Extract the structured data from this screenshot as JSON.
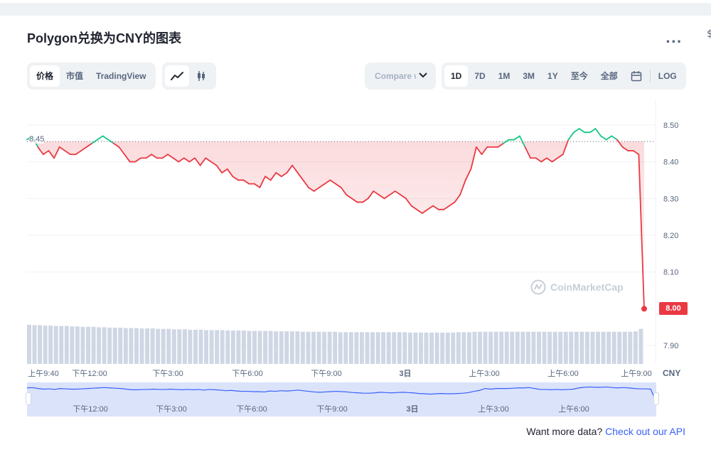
{
  "title": "Polygon兑换为CNY的图表",
  "more_label": "...",
  "edge_mark": "$",
  "view_tabs": [
    {
      "label": "价格",
      "active": true
    },
    {
      "label": "市值",
      "active": false
    },
    {
      "label": "TradingView",
      "active": false
    }
  ],
  "chart_type_icons": [
    {
      "name": "line-chart-icon",
      "active": true
    },
    {
      "name": "candlestick-icon",
      "active": false
    }
  ],
  "compare": {
    "label": "Compare with"
  },
  "ranges": [
    {
      "label": "1D",
      "active": true
    },
    {
      "label": "7D",
      "active": false
    },
    {
      "label": "1M",
      "active": false
    },
    {
      "label": "3M",
      "active": false
    },
    {
      "label": "1Y",
      "active": false
    },
    {
      "label": "至今",
      "active": false
    },
    {
      "label": "全部",
      "active": false
    }
  ],
  "calendar_icon": "calendar-icon",
  "log_label": "LOG",
  "colors": {
    "up": "#16c784",
    "down": "#ea3943",
    "grid": "#eff2f5",
    "volume": "#cfd6e4",
    "nav_fill": "#dbe3fb",
    "nav_line": "#3861fb"
  },
  "watermark": "CoinMarketCap",
  "footer": {
    "text": "Want more data?",
    "link": "Check out our API"
  },
  "chart_data": {
    "type": "line",
    "currency": "CNY",
    "ylim": [
      7.85,
      8.55
    ],
    "y_ticks": [
      "8.50",
      "8.40",
      "8.30",
      "8.20",
      "8.10",
      "7.90"
    ],
    "reference": {
      "label": "8.45",
      "value": 8.455
    },
    "last_price": {
      "label": "8.00",
      "value": 8.0
    },
    "x_tick_labels": [
      "上午9:40",
      "下午12:00",
      "下午3:00",
      "下午6:00",
      "下午9:00",
      "3日",
      "上午3:00",
      "上午6:00",
      "上午9:00"
    ],
    "nav_tick_labels": [
      "下午12:00",
      "下午3:00",
      "下午6:00",
      "下午9:00",
      "3日",
      "上午3:00",
      "上午6:00"
    ],
    "grid": true,
    "series": [
      {
        "values": [
          8.46,
          8.47,
          8.44,
          8.42,
          8.43,
          8.41,
          8.44,
          8.43,
          8.42,
          8.42,
          8.43,
          8.44,
          8.45,
          8.46,
          8.47,
          8.46,
          8.45,
          8.44,
          8.42,
          8.4,
          8.4,
          8.41,
          8.41,
          8.42,
          8.41,
          8.41,
          8.42,
          8.41,
          8.4,
          8.41,
          8.4,
          8.41,
          8.39,
          8.41,
          8.4,
          8.39,
          8.37,
          8.38,
          8.36,
          8.35,
          8.35,
          8.34,
          8.34,
          8.33,
          8.36,
          8.35,
          8.37,
          8.36,
          8.37,
          8.39,
          8.37,
          8.35,
          8.33,
          8.32,
          8.33,
          8.34,
          8.35,
          8.34,
          8.33,
          8.31,
          8.3,
          8.29,
          8.29,
          8.3,
          8.32,
          8.31,
          8.3,
          8.31,
          8.32,
          8.31,
          8.3,
          8.28,
          8.27,
          8.26,
          8.27,
          8.28,
          8.27,
          8.27,
          8.28,
          8.29,
          8.31,
          8.35,
          8.38,
          8.44,
          8.42,
          8.44,
          8.44,
          8.44,
          8.45,
          8.46,
          8.46,
          8.47,
          8.44,
          8.41,
          8.41,
          8.4,
          8.41,
          8.4,
          8.41,
          8.42,
          8.46,
          8.48,
          8.49,
          8.48,
          8.48,
          8.49,
          8.47,
          8.46,
          8.47,
          8.46,
          8.44,
          8.43,
          8.43,
          8.42,
          8.0
        ],
        "volume": [
          0.95,
          0.94,
          0.94,
          0.93,
          0.93,
          0.92,
          0.92,
          0.92,
          0.91,
          0.91,
          0.9,
          0.9,
          0.9,
          0.89,
          0.89,
          0.88,
          0.88,
          0.88,
          0.87,
          0.87,
          0.87,
          0.86,
          0.86,
          0.86,
          0.85,
          0.85,
          0.85,
          0.84,
          0.84,
          0.84,
          0.83,
          0.83,
          0.83,
          0.82,
          0.82,
          0.82,
          0.82,
          0.81,
          0.81,
          0.81,
          0.81,
          0.8,
          0.8,
          0.8,
          0.8,
          0.8,
          0.79,
          0.79,
          0.79,
          0.79,
          0.79,
          0.78,
          0.78,
          0.78,
          0.78,
          0.78,
          0.78,
          0.78,
          0.77,
          0.77,
          0.77,
          0.77,
          0.77,
          0.77,
          0.77,
          0.77,
          0.77,
          0.77,
          0.77,
          0.77,
          0.77,
          0.76,
          0.76,
          0.76,
          0.76,
          0.76,
          0.76,
          0.76,
          0.76,
          0.76,
          0.77,
          0.77,
          0.77,
          0.78,
          0.78,
          0.78,
          0.78,
          0.78,
          0.78,
          0.78,
          0.78,
          0.78,
          0.78,
          0.78,
          0.78,
          0.78,
          0.78,
          0.78,
          0.78,
          0.78,
          0.78,
          0.78,
          0.78,
          0.78,
          0.78,
          0.78,
          0.78,
          0.78,
          0.78,
          0.78,
          0.78,
          0.78,
          0.78,
          0.79,
          0.85
        ]
      }
    ]
  }
}
